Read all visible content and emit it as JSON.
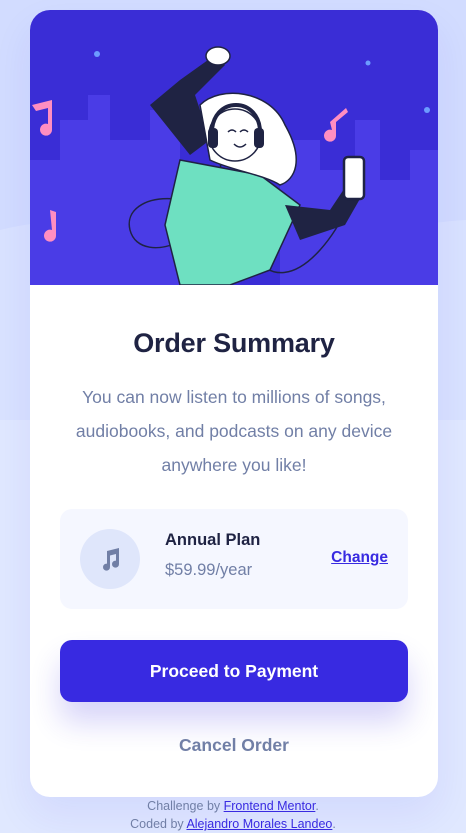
{
  "card": {
    "title": "Order Summary",
    "description": "You can now listen to millions of songs, audiobooks, and podcasts on any device anywhere you like!"
  },
  "plan": {
    "icon": "music-note-icon",
    "name": "Annual Plan",
    "price": "$59.99/year",
    "change_label": "Change"
  },
  "actions": {
    "proceed_label": "Proceed to Payment",
    "cancel_label": "Cancel Order"
  },
  "attribution": {
    "line1_prefix": "Challenge by ",
    "line1_link": "Frontend Mentor",
    "line1_suffix": ".",
    "line2_prefix": "Coded by ",
    "line2_link": "Alejandro Morales Landeo",
    "line2_suffix": "."
  },
  "colors": {
    "page_bg": "#e0e8ff",
    "hero_bg": "#3a2dd6",
    "primary": "#382ae1",
    "dark_text": "#1f2343",
    "muted_text": "#717fa6",
    "plan_bg": "#f5f7ff"
  }
}
